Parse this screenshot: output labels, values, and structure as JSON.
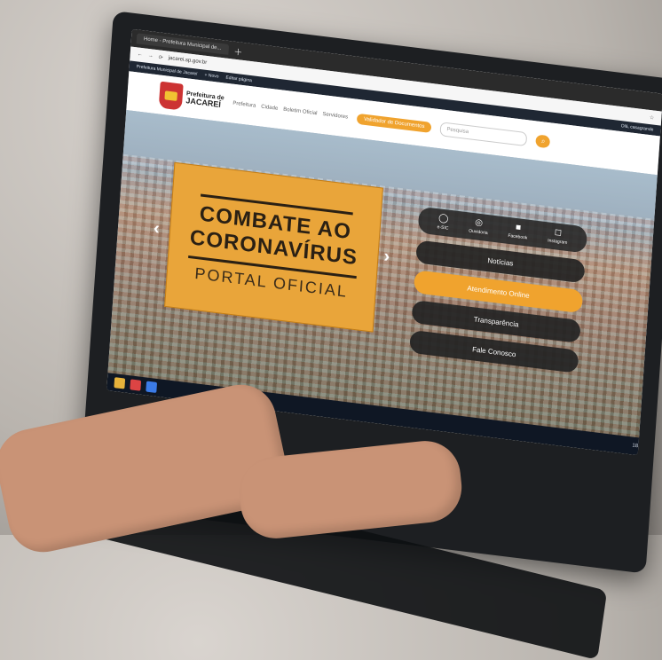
{
  "browser": {
    "tab_title": "Home - Prefeitura Municipal de...",
    "url": "jacarei.sp.gov.br",
    "bookmarks": [
      "Prefeitura Municipal de Jacareí",
      "+ Novo",
      "Editar página"
    ],
    "user_greeting": "Olá, casagrande"
  },
  "site": {
    "logo": {
      "line1": "Prefeitura de",
      "line2": "JACAREÍ"
    },
    "nav": [
      "Prefeitura",
      "Cidade",
      "Boletim Oficial",
      "Servidores"
    ],
    "highlight_button": "Validador de Documentos",
    "search_placeholder": "Pesquisa",
    "hero": {
      "line1": "COMBATE AO",
      "line2": "CORONAVÍRUS",
      "line3": "PORTAL OFICIAL"
    },
    "social": [
      {
        "label": "e-SIC",
        "icon": "chat-icon"
      },
      {
        "label": "Ouvidoria",
        "icon": "speech-icon"
      },
      {
        "label": "Facebook",
        "icon": "facebook-icon"
      },
      {
        "label": "Instagram",
        "icon": "instagram-icon"
      }
    ],
    "links": [
      "Notícias",
      "Atendimento Online",
      "Transparência",
      "Fale Conosco"
    ]
  },
  "taskbar": {
    "time": "18:05"
  }
}
